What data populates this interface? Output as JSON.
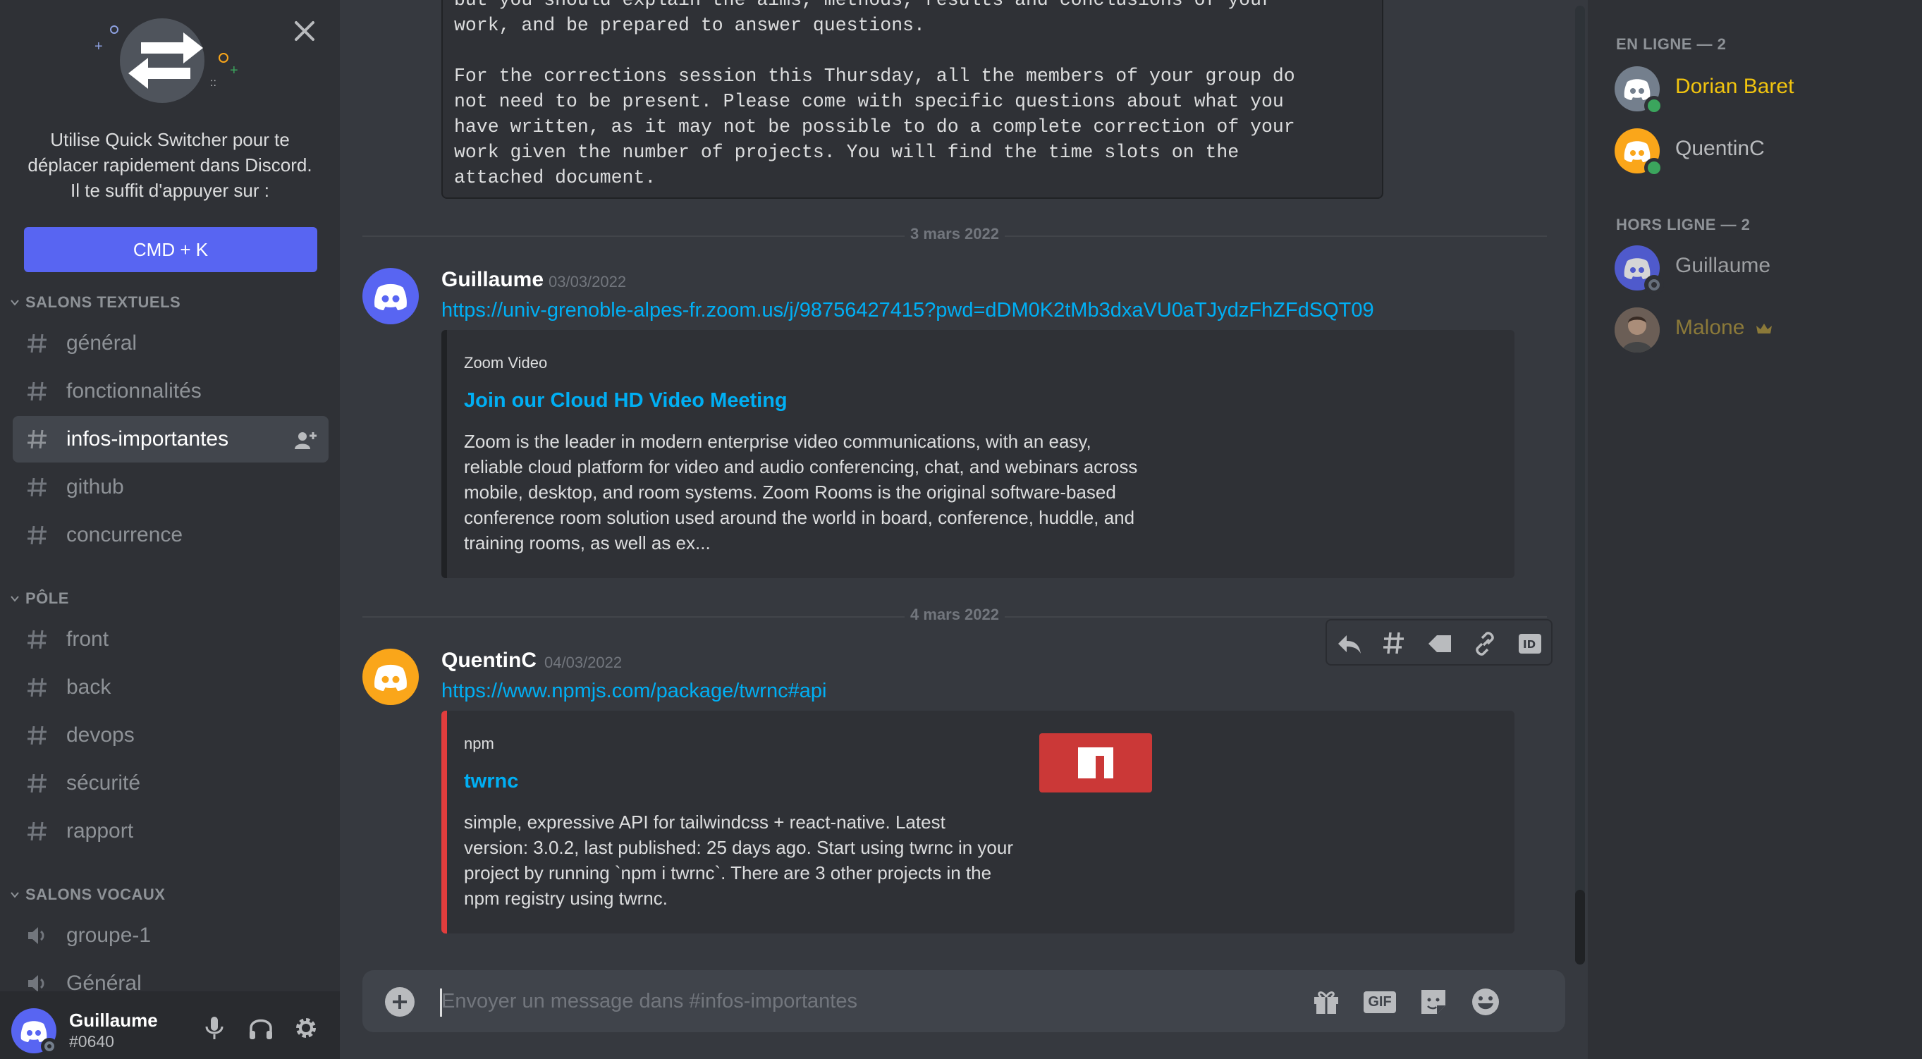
{
  "quick_switcher": {
    "lines": [
      "Utilise Quick Switcher pour te",
      "déplacer rapidement dans Discord.",
      "Il te suffit d'appuyer sur :"
    ],
    "shortcut": "CMD + K"
  },
  "categories": {
    "text": "SALONS TEXTUELS",
    "pole": "PÔLE",
    "voice": "SALONS VOCAUX"
  },
  "channels": {
    "text": [
      "général",
      "fonctionnalités",
      "infos-importantes",
      "github",
      "concurrence"
    ],
    "pole": [
      "front",
      "back",
      "devops",
      "sécurité",
      "rapport"
    ],
    "voice": [
      "groupe-1",
      "Général"
    ],
    "active": "infos-importantes"
  },
  "user": {
    "name": "Guillaume",
    "tag": "#0640"
  },
  "messages": {
    "code_lines": [
      "but you should explain the aims, methods, results and conclusions of your",
      "work, and be prepared to answer questions.",
      "",
      "For the corrections session this Thursday, all the members of your group do",
      "not need to be present. Please come with specific questions about what you",
      "have written, as it may not be possible to do a complete correction of your",
      "work given the number of projects. You will find the time slots on the",
      "attached document."
    ],
    "divider1": "3 mars 2022",
    "divider2": "4 mars 2022",
    "m1": {
      "author": "Guillaume",
      "timestamp": "03/03/2022",
      "link": "https://univ-grenoble-alpes-fr.zoom.us/j/98756427415?pwd=dDM0K2tMb3dxaVU0aTJydzFhZFdSQT09",
      "embed": {
        "provider": "Zoom Video",
        "title": "Join our Cloud HD Video Meeting",
        "desc_lines": [
          "Zoom is the leader in modern enterprise video communications, with an easy,",
          "reliable cloud platform for video and audio conferencing, chat, and webinars across",
          "mobile, desktop, and room systems. Zoom Rooms is the original software-based",
          "conference room solution used around the world in board, conference, huddle, and",
          "training rooms, as well as ex..."
        ]
      }
    },
    "m2": {
      "author": "QuentinC",
      "timestamp": "04/03/2022",
      "link": "https://www.npmjs.com/package/twrnc#api",
      "embed": {
        "provider": "npm",
        "title": "twrnc",
        "desc_lines": [
          "simple, expressive API for tailwindcss + react-native. Latest",
          "version: 3.0.2, last published: 25 days ago. Start using twrnc in your",
          "project by running `npm i twrnc`. There are 3 other projects in the",
          "npm registry using twrnc."
        ]
      }
    }
  },
  "composer": {
    "placeholder": "Envoyer un message dans #infos-importantes",
    "gif_label": "GIF"
  },
  "members": {
    "online_header": "EN LIGNE — 2",
    "offline_header": "HORS LIGNE — 2",
    "online": [
      {
        "name": "Dorian Baret",
        "color": "#f1c40f"
      },
      {
        "name": "QuentinC",
        "color": "#b9bbbe"
      }
    ],
    "offline": [
      {
        "name": "Guillaume",
        "color": "#b9bbbe"
      },
      {
        "name": "Malone",
        "color": "#a38c3a"
      }
    ]
  },
  "colors": {
    "blurple": "#5865f2",
    "link": "#00aff4",
    "online": "#3ba55d",
    "npm_red": "#cb3837",
    "orange_avatar": "#faa61a"
  }
}
